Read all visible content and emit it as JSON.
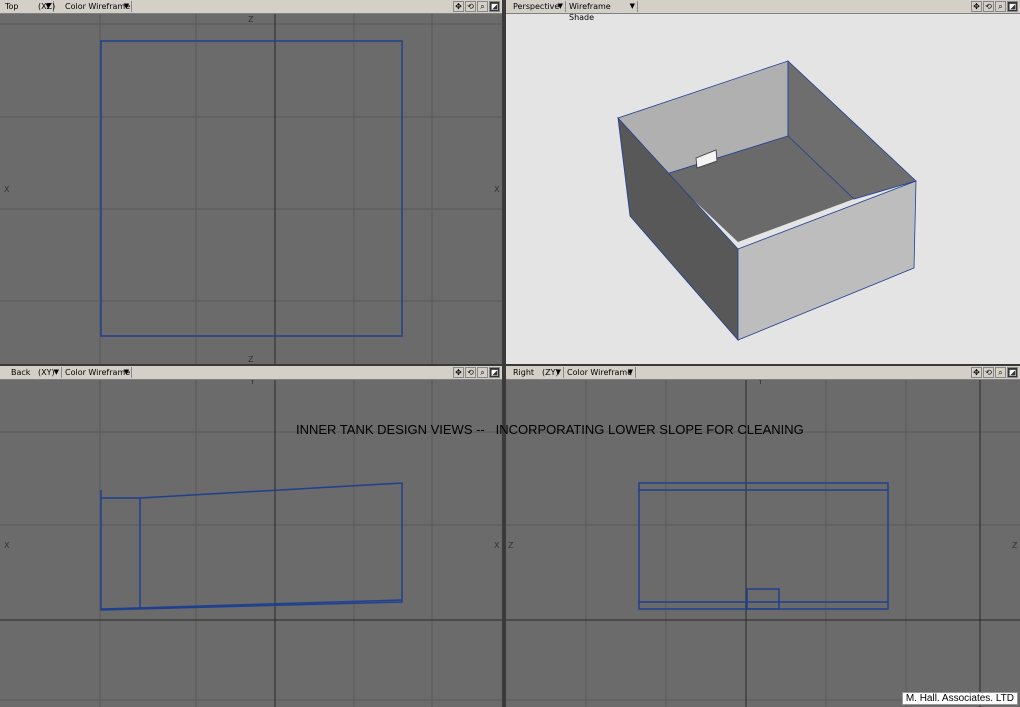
{
  "viewports": {
    "top": {
      "view": "Top",
      "axes": "(XZ)",
      "mode": "Color Wireframe"
    },
    "persp": {
      "view": "Perspective",
      "mode": "Wireframe Shade"
    },
    "back": {
      "view": "Back",
      "axes": "(XY)",
      "mode": "Color Wireframe"
    },
    "right": {
      "view": "Right",
      "axes": "(ZY)",
      "mode": "Color Wireframe"
    }
  },
  "axis_labels": {
    "z": "Z",
    "x": "X",
    "y": "Y"
  },
  "title": "INNER TANK DESIGN VIEWS --   INCORPORATING LOWER SLOPE FOR CLEANING",
  "credit": "M. Hall. Associates. LTD",
  "colors": {
    "wire": "#1f3f8f",
    "grid": "#5a5a5a",
    "axis": "#222222"
  }
}
